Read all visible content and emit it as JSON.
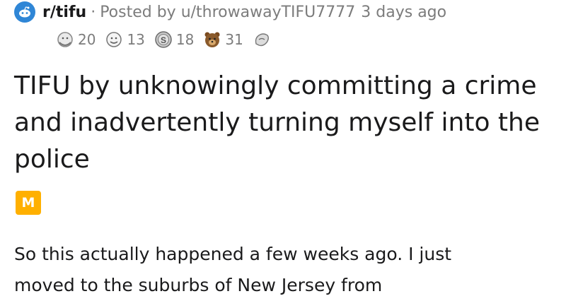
{
  "post": {
    "subreddit": "r/tifu",
    "separator": "·",
    "posted_by": "Posted by u/throwawayTIFU7777",
    "time_ago": "3 days ago",
    "awards": [
      {
        "icon": "hug-award-icon",
        "count": "20"
      },
      {
        "icon": "face-award-icon",
        "count": "13"
      },
      {
        "icon": "silver-award-icon",
        "count": "18"
      },
      {
        "icon": "bear-award-icon",
        "count": "31"
      },
      {
        "icon": "gesture-award-icon",
        "count": ""
      }
    ],
    "title": "TIFU by unknowingly committing a crime and inadvertently turning myself into the police",
    "flair": "M",
    "body_lines": [
      "So this actually happened a few weeks ago. I just",
      "moved to the suburbs of New Jersey from"
    ]
  },
  "colors": {
    "subreddit_icon_bg": "#2f86d6",
    "flair_bg": "#ffb000",
    "meta_text": "#7c7c7c",
    "primary_text": "#1a1a1b"
  }
}
